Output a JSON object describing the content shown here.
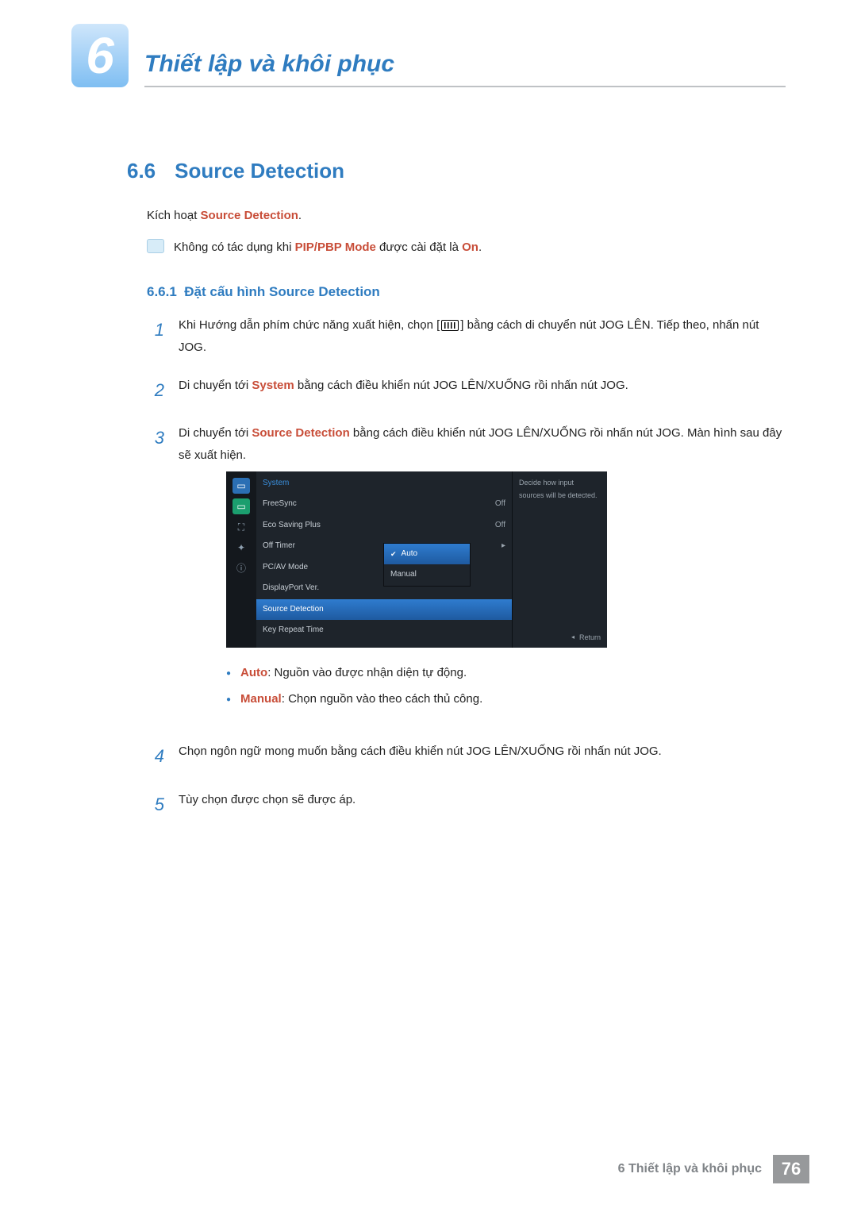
{
  "chapter": {
    "number": "6",
    "title": "Thiết lập và khôi phục"
  },
  "section": {
    "number": "6.6",
    "title": "Source Detection"
  },
  "activate": {
    "prefix": "Kích hoạt ",
    "term": "Source Detection",
    "suffix": "."
  },
  "note": {
    "p1": "Không có tác dụng khi ",
    "term": "PIP/PBP Mode",
    "p2": " được cài đặt là ",
    "on": "On",
    "p3": "."
  },
  "subsection": {
    "number": "6.6.1",
    "title": "Đặt cấu hình Source Detection"
  },
  "steps": {
    "s1": {
      "num": "1",
      "p1": "Khi Hướng dẫn phím chức năng xuất hiện, chọn [",
      "p2": "] bằng cách di chuyển nút JOG LÊN. Tiếp theo, nhấn nút JOG."
    },
    "s2": {
      "num": "2",
      "p1": "Di chuyển tới ",
      "term": "System",
      "p2": " bằng cách điều khiển nút JOG LÊN/XUỐNG rồi nhấn nút JOG."
    },
    "s3": {
      "num": "3",
      "p1": "Di chuyển tới ",
      "term": "Source Detection",
      "p2": " bằng cách điều khiển nút JOG LÊN/XUỐNG rồi nhấn nút JOG. Màn hình sau đây sẽ xuất hiện."
    },
    "s4": {
      "num": "4",
      "text": "Chọn ngôn ngữ mong muốn bằng cách điều khiển nút JOG LÊN/XUỐNG rồi nhấn nút JOG."
    },
    "s5": {
      "num": "5",
      "text": "Tùy chọn được chọn sẽ được áp."
    }
  },
  "bullets": {
    "b1": {
      "term": "Auto",
      "text": ": Nguồn vào được nhận diện tự động."
    },
    "b2": {
      "term": "Manual",
      "text": ": Chọn nguồn vào theo cách thủ công."
    }
  },
  "osd": {
    "title": "System",
    "rows": {
      "freesync": {
        "label": "FreeSync",
        "value": "Off"
      },
      "eco": {
        "label": "Eco Saving Plus",
        "value": "Off"
      },
      "offtimer": {
        "label": "Off Timer",
        "value": "▸"
      },
      "pcav": {
        "label": "PC/AV Mode",
        "value": ""
      },
      "dpver": {
        "label": "DisplayPort Ver.",
        "value": ""
      },
      "src": {
        "label": "Source Detection",
        "value": ""
      },
      "keyrep": {
        "label": "Key Repeat Time",
        "value": ""
      }
    },
    "submenu": {
      "auto": "Auto",
      "manual": "Manual"
    },
    "help": "Decide how input sources will be detected.",
    "return": "Return"
  },
  "footer": {
    "label": "6 Thiết lập và khôi phục",
    "page": "76"
  }
}
